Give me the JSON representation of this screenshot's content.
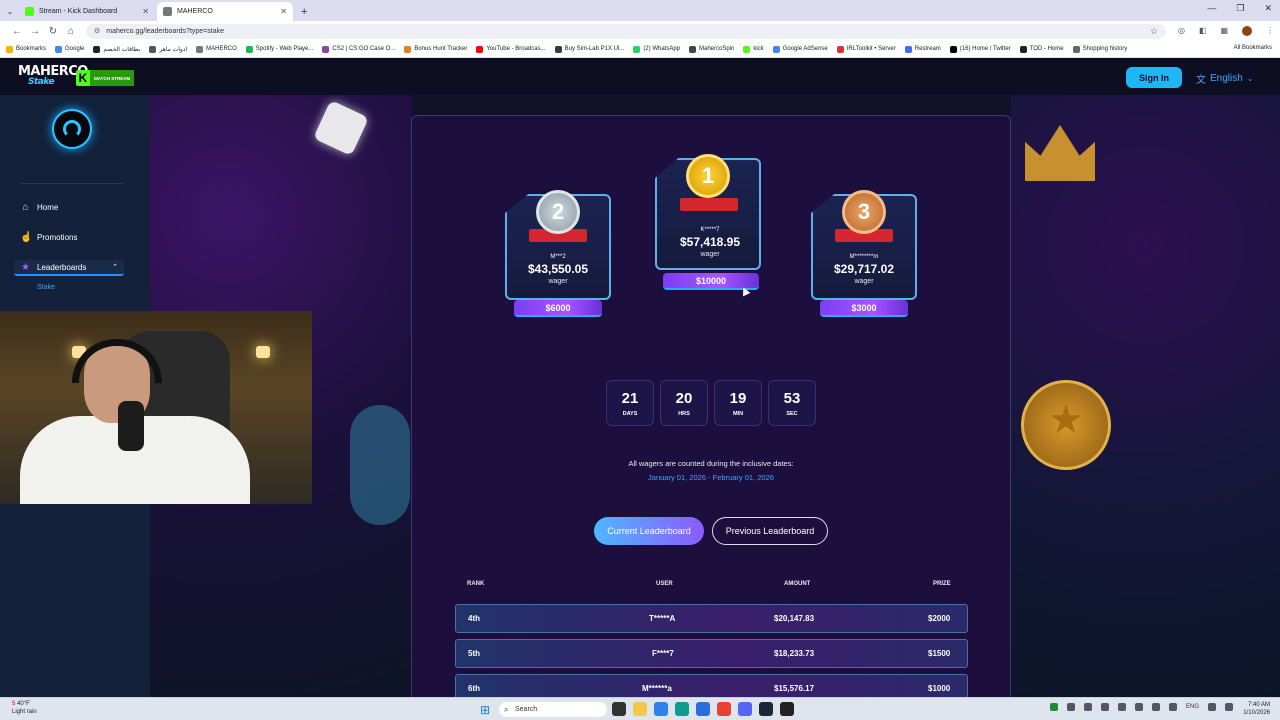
{
  "browser": {
    "tabs": [
      {
        "label": "Stream - Kick Dashboard",
        "color": "#53fc18",
        "active": false
      },
      {
        "label": "MAHERCO",
        "color": "#777777",
        "active": true
      }
    ],
    "url": "maherco.gg/leaderboards?type=stake",
    "bookmarks": [
      "Bookmarks",
      "Google",
      "بطاقات الخصم",
      "ادوات ماهر",
      "MAHERCO",
      "Spotify - Web Playe...",
      "CS2 | CS:GO Case O...",
      "Bonus Hunt Tracker",
      "YouTube - Broadcas...",
      "Buy Sim-Lab P1X Ul...",
      "(2) WhatsApp",
      "MahercoSpin",
      "kick",
      "Google AdSense",
      "IRLToolkit • Server",
      "Restream",
      "(16) Home / Twitter",
      "TOD - Home",
      "Shopping history"
    ],
    "all_bookmarks": "All Bookmarks"
  },
  "site": {
    "logo_top": "MAHERCO",
    "logo_bottom": "Stake",
    "kick_badge": "WATCH STREAM",
    "signin": "Sign In",
    "language": "English"
  },
  "sidebar": {
    "items": [
      {
        "label": "Home",
        "icon": "home-icon"
      },
      {
        "label": "Promotions",
        "icon": "thumbs-up-icon"
      },
      {
        "label": "Leaderboards",
        "icon": "star-icon"
      }
    ],
    "sub_item": "Stake"
  },
  "podium": {
    "first": {
      "rank": "1",
      "user": "K*****7",
      "amount": "$57,418.95",
      "wager": "wager",
      "prize": "$10000"
    },
    "second": {
      "rank": "2",
      "user": "M***2",
      "amount": "$43,550.05",
      "wager": "wager",
      "prize": "$6000"
    },
    "third": {
      "rank": "3",
      "user": "M********m",
      "amount": "$29,717.02",
      "wager": "wager",
      "prize": "$3000"
    }
  },
  "countdown": [
    {
      "value": "21",
      "label": "DAYS"
    },
    {
      "value": "20",
      "label": "HRS"
    },
    {
      "value": "19",
      "label": "MIN"
    },
    {
      "value": "53",
      "label": "SEC"
    }
  ],
  "wager_note": "All wagers are counted during the inclusive dates:",
  "wager_dates": "January 01, 2026 - February 01, 2026",
  "buttons": {
    "current": "Current Leaderboard",
    "previous": "Previous Leaderboard"
  },
  "table": {
    "headers": {
      "rank": "RANK",
      "user": "USER",
      "amount": "AMOUNT",
      "prize": "PRIZE"
    },
    "rows": [
      {
        "rank": "4th",
        "user": "T*****A",
        "amount": "$20,147.83",
        "prize": "$2000"
      },
      {
        "rank": "5th",
        "user": "F****7",
        "amount": "$18,233.73",
        "prize": "$1500"
      },
      {
        "rank": "6th",
        "user": "M******a",
        "amount": "$15,576.17",
        "prize": "$1000"
      }
    ]
  },
  "taskbar": {
    "temp": "40°F",
    "weather": "Light rain",
    "weather_badge": "5",
    "search": "Search",
    "lang": "ENG",
    "time": "7:40 AM",
    "date": "1/10/2026"
  },
  "colors": {
    "accent": "#1fb6f5",
    "purple": "#8b5bff",
    "kick": "#53fc18"
  }
}
